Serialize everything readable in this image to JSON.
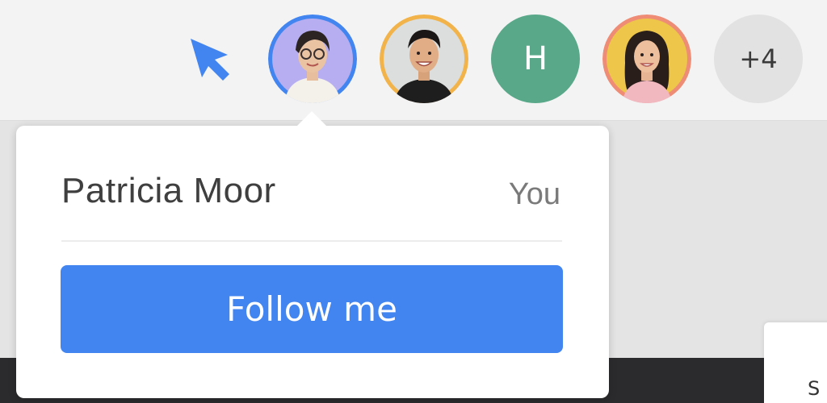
{
  "presence_bar": {
    "avatars": [
      {
        "name": "patricia-avatar",
        "type": "photo",
        "ring_color": "#4285f0"
      },
      {
        "name": "collaborator-photo-avatar-2",
        "type": "photo",
        "ring_color": "#f1b34a"
      },
      {
        "name": "collaborator-initial-avatar",
        "type": "initial",
        "letter": "H",
        "color": "#5aa88a"
      },
      {
        "name": "collaborator-photo-avatar-4",
        "type": "photo",
        "ring_color": "#ee8c76"
      }
    ],
    "overflow_count_label": "+4",
    "pointer_color": "#4285f0"
  },
  "user_popover": {
    "user_name": "Patricia Moor",
    "self_label": "You",
    "follow_button_label": "Follow me",
    "accent_color": "#4285f0"
  },
  "background_card": {
    "partial_text": "S"
  }
}
